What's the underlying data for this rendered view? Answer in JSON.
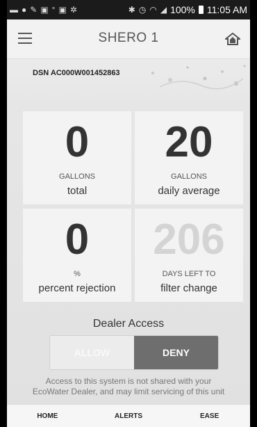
{
  "status_bar": {
    "battery": "100%",
    "time": "11:05 AM"
  },
  "app_bar": {
    "title": "SHERO 1"
  },
  "dsn": "DSN AC000W001452863",
  "tiles": [
    {
      "value": "0",
      "unit": "GALLONS",
      "label": "total"
    },
    {
      "value": "20",
      "unit": "GALLONS",
      "label": "daily average"
    },
    {
      "value": "0",
      "unit": "%",
      "label": "percent rejection"
    },
    {
      "value": "206",
      "unit": "DAYS LEFT TO",
      "label": "filter change"
    }
  ],
  "dealer_access": {
    "title": "Dealer Access",
    "allow_label": "ALLOW",
    "deny_label": "DENY",
    "selected": "DENY",
    "note_line1": "Access to this system is not shared with your",
    "note_line2": "EcoWater Dealer, and may limit servicing of this unit"
  },
  "bottom_nav": {
    "home": "HOME",
    "alerts": "ALERTS",
    "ease": "EASE"
  },
  "colors": {
    "status_bar_bg": "#1b1b1b",
    "deny_selected_bg": "#6e6e6e",
    "faded_value": "#d4d4d4"
  }
}
